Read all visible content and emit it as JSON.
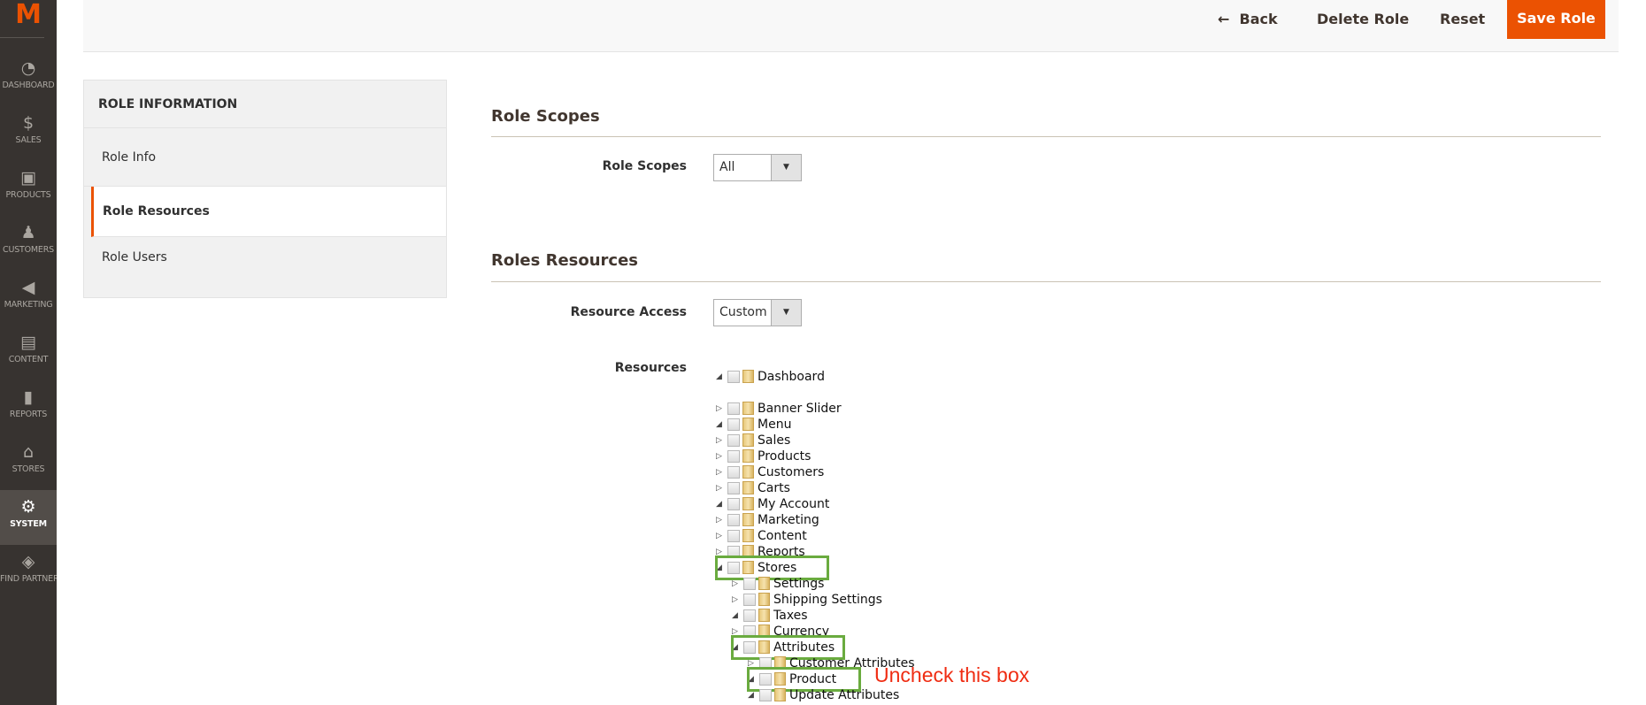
{
  "nav": {
    "logo": "M",
    "items": [
      {
        "label": "DASHBOARD",
        "icon": "◔"
      },
      {
        "label": "SALES",
        "icon": "$"
      },
      {
        "label": "PRODUCTS",
        "icon": "▣"
      },
      {
        "label": "CUSTOMERS",
        "icon": "♟"
      },
      {
        "label": "MARKETING",
        "icon": "◀"
      },
      {
        "label": "CONTENT",
        "icon": "▤"
      },
      {
        "label": "REPORTS",
        "icon": "▮"
      },
      {
        "label": "STORES",
        "icon": "⌂"
      },
      {
        "label": "SYSTEM",
        "icon": "⚙",
        "active": true
      },
      {
        "label": "FIND PARTNERS & EXTENSIONS",
        "icon": "◈"
      }
    ]
  },
  "header": {
    "back_icon": "←",
    "back": "Back",
    "delete": "Delete Role",
    "reset": "Reset",
    "save": "Save Role",
    "accent": "#eb5202"
  },
  "panel": {
    "title": "ROLE INFORMATION",
    "tabs": [
      "Role Info",
      "Role Resources",
      "Role Users"
    ],
    "active": "Role Resources"
  },
  "scopes": {
    "heading": "Role Scopes",
    "label": "Role Scopes",
    "value": "All"
  },
  "resources": {
    "heading": "Roles Resources",
    "access_label": "Resource Access",
    "access_value": "Custom",
    "resources_label": "Resources",
    "tree": [
      {
        "label": "Dashboard",
        "level": 0,
        "expanded": true
      },
      {
        "label": "Banner Slider",
        "level": 0,
        "expanded": false
      },
      {
        "label": "Menu",
        "level": 0,
        "expanded": true
      },
      {
        "label": "Sales",
        "level": 0,
        "expanded": false
      },
      {
        "label": "Products",
        "level": 0,
        "expanded": false
      },
      {
        "label": "Customers",
        "level": 0,
        "expanded": false
      },
      {
        "label": "Carts",
        "level": 0,
        "expanded": false
      },
      {
        "label": "My Account",
        "level": 0,
        "expanded": true
      },
      {
        "label": "Marketing",
        "level": 0,
        "expanded": false
      },
      {
        "label": "Content",
        "level": 0,
        "expanded": false
      },
      {
        "label": "Reports",
        "level": 0,
        "expanded": false
      },
      {
        "label": "Stores",
        "level": 0,
        "expanded": true,
        "highlight": true
      },
      {
        "label": "Settings",
        "level": 1,
        "expanded": false
      },
      {
        "label": "Shipping Settings",
        "level": 1,
        "expanded": false
      },
      {
        "label": "Taxes",
        "level": 1,
        "expanded": true
      },
      {
        "label": "Currency",
        "level": 1,
        "expanded": false
      },
      {
        "label": "Attributes",
        "level": 1,
        "expanded": true,
        "highlight": true
      },
      {
        "label": "Customer Attributes",
        "level": 2,
        "expanded": false
      },
      {
        "label": "Product",
        "level": 2,
        "expanded": true,
        "highlight": true
      },
      {
        "label": "Update Attributes",
        "level": 2,
        "expanded": true
      }
    ]
  },
  "annotation": {
    "text": "Uncheck this box",
    "color": "#ef2c12",
    "box_color": "#6aab3f"
  }
}
